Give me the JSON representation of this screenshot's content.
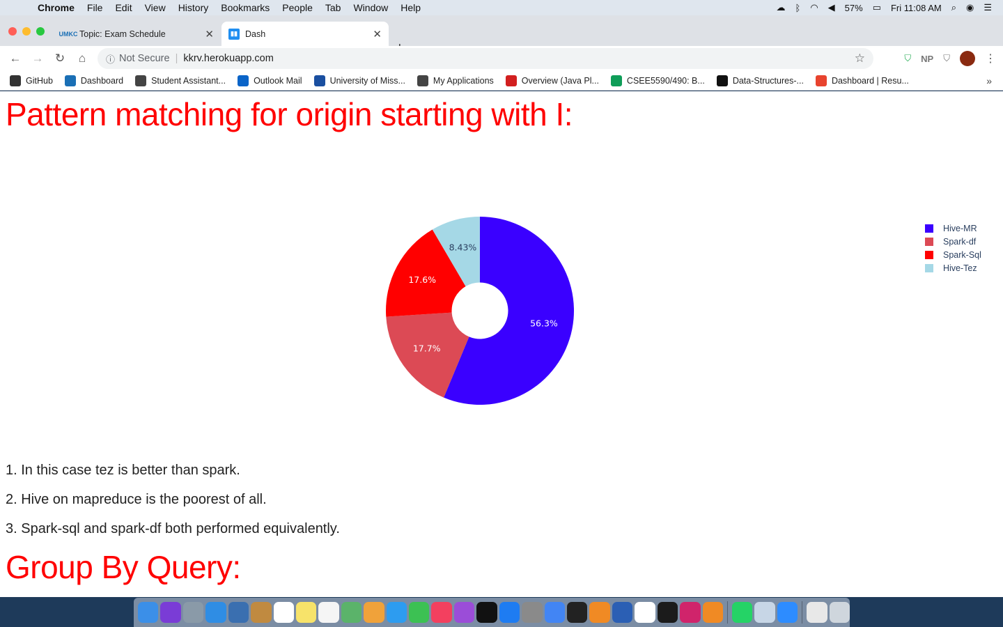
{
  "menubar": {
    "apple_icon": "apple-icon",
    "items": [
      "Chrome",
      "File",
      "Edit",
      "View",
      "History",
      "Bookmarks",
      "People",
      "Tab",
      "Window",
      "Help"
    ],
    "battery": "57%",
    "clock": "Fri 11:08 AM"
  },
  "tabs": [
    {
      "title": "Topic: Exam Schedule",
      "icon": "umkc-icon"
    },
    {
      "title": "Dash",
      "icon": "dash-chart-icon"
    }
  ],
  "toolbar": {
    "security": "Not Secure",
    "url": "kkrv.herokuapp.com",
    "extensions": [
      "shield-check-icon",
      "NP",
      "shield-icon",
      "profile-avatar"
    ]
  },
  "bookmarks": [
    {
      "label": "GitHub",
      "color": "#333333"
    },
    {
      "label": "Dashboard",
      "color": "#1a6fb5"
    },
    {
      "label": "Student Assistant...",
      "color": "#444444"
    },
    {
      "label": "Outlook Mail",
      "color": "#0a64c8"
    },
    {
      "label": "University of Miss...",
      "color": "#1a4fa0"
    },
    {
      "label": "My Applications",
      "color": "#444444"
    },
    {
      "label": "Overview (Java Pl...",
      "color": "#d21f1f"
    },
    {
      "label": "CSEE5590/490: B...",
      "color": "#0f9d58"
    },
    {
      "label": "Data-Structures-...",
      "color": "#111111"
    },
    {
      "label": "Dashboard | Resu...",
      "color": "#e8432e"
    }
  ],
  "page": {
    "heading1": "Pattern matching for origin starting with I:",
    "notes": [
      "1. In this case tez is better than spark.",
      "2. Hive on mapreduce is the poorest of all.",
      "3. Spark-sql and spark-df both performed equivalently."
    ],
    "heading2": "Group By Query:"
  },
  "chart_data": {
    "type": "pie",
    "hole": 0.3,
    "labels": [
      "Hive-MR",
      "Spark-df",
      "Spark-Sql",
      "Hive-Tez"
    ],
    "values": [
      56.3,
      17.7,
      17.6,
      8.43
    ],
    "display_labels": [
      "56.3%",
      "17.7%",
      "17.6%",
      "8.43%"
    ],
    "colors": [
      "#3a00ff",
      "#dc4a55",
      "#ff0000",
      "#a5d8e6"
    ],
    "legend_position": "top-right"
  }
}
